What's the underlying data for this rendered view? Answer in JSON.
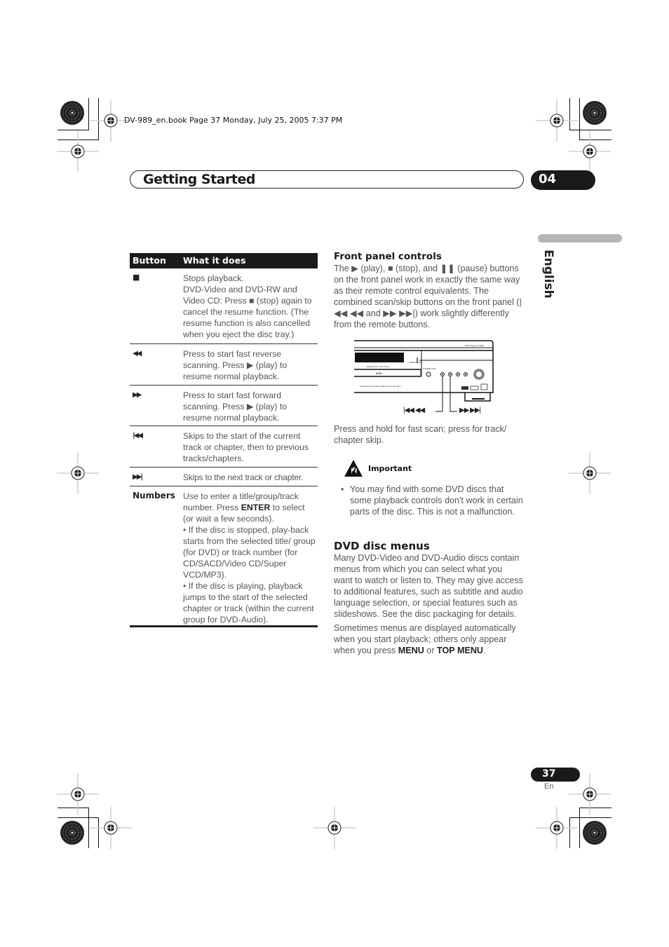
{
  "print_header": {
    "text": "DV-989_en.book  Page 37  Monday, July 25, 2005  7:37 PM"
  },
  "chapter": {
    "title": "Getting Started",
    "number": "04"
  },
  "language_tab": {
    "label": "English"
  },
  "table": {
    "headers": [
      "Button",
      "What it does"
    ],
    "rows": [
      {
        "button_icon": "stop-icon",
        "button_glyph": "■",
        "description": [
          "Stops playback.",
          "DVD-Video and DVD-RW and Video CD: Press ■ (stop) again to cancel the resume function. (The resume function is also cancelled when you eject the disc tray.)"
        ]
      },
      {
        "button_icon": "fast-reverse-icon",
        "button_glyph": "◀◀",
        "description": [
          "Press to start fast reverse scanning. Press ▶ (play) to resume normal playback."
        ]
      },
      {
        "button_icon": "fast-forward-icon",
        "button_glyph": "▶▶",
        "description": [
          "Press to start fast forward scanning. Press ▶ (play) to resume normal playback."
        ]
      },
      {
        "button_icon": "skip-previous-icon",
        "button_glyph": "|◀◀",
        "description": [
          "Skips to the start of the current track or chapter, then to previous tracks/chapters."
        ]
      },
      {
        "button_icon": "skip-next-icon",
        "button_glyph": "▶▶|",
        "description": [
          "Skips to the next track or chapter."
        ]
      },
      {
        "button_label": "Numbers",
        "description_parts": {
          "p1_before": "Use to enter a title/group/track number. Press ",
          "p1_bold": "ENTER",
          "p1_after": " to select (or wait a few seconds).",
          "p2": "• If the disc is stopped, play-back starts from the selected title/ group (for DVD) or track number (for CD/SACD/Video CD/Super VCD/MP3).",
          "p3": "• If the disc is playing, playback jumps to the start of the selected chapter or track (within the current group for DVD-Audio)."
        }
      }
    ]
  },
  "front_panel": {
    "heading": "Front panel controls",
    "body": "The ▶ (play), ■ (stop), and ❚❚ (pause) buttons on the front panel work in exactly the same way as their remote control equivalents. The combined scan/skip buttons on the front panel (|◀◀ ◀◀ and ▶▶ ▶▶|) work slightly differently from the remote buttons.",
    "diagram_labels": {
      "left": "|◀◀ ◀◀",
      "right": "▶▶ ▶▶|"
    },
    "caption": "Press and hold for fast scan; press for track/ chapter skip."
  },
  "important": {
    "label": "Important",
    "icon": "warning-hand-icon",
    "bullets": [
      "You may find with some DVD discs that some playback controls don't work in certain parts of the disc. This is not a malfunction."
    ]
  },
  "dvd_menus": {
    "heading": "DVD disc menus",
    "para1": "Many DVD-Video and DVD-Audio discs contain menus from which you can select what you want to watch or listen to. They may give access to additional features, such as subtitle and audio language selection, or special features such as slideshows. See the disc packaging for details.",
    "para2_before": "Sometimes menus are displayed automatically when you start playback; others only appear when you press ",
    "para2_bold1": "MENU",
    "para2_mid": " or ",
    "para2_bold2": "TOP MENU",
    "para2_after": "."
  },
  "footer": {
    "page_number": "37",
    "language_code": "En"
  }
}
